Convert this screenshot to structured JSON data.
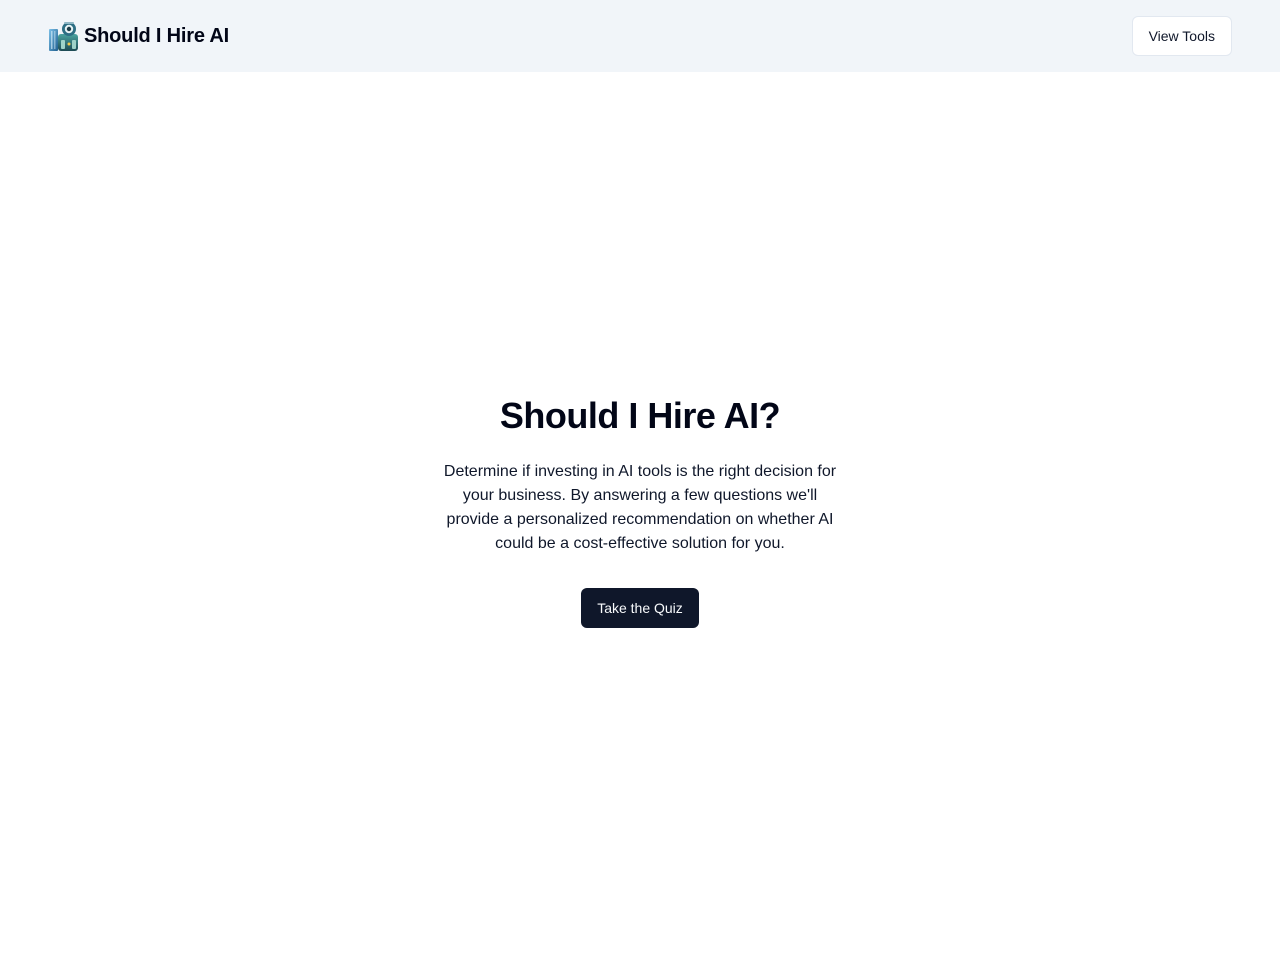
{
  "header": {
    "brand_name": "Should I Hire AI",
    "logo_icon": "robot-briefcase-logo-icon",
    "view_tools_label": "View Tools"
  },
  "hero": {
    "title": "Should I Hire AI?",
    "description": "Determine if investing in AI tools is the right decision for your business. By answering a few questions we'll provide a personalized recommendation on whether AI could be a cost-effective solution for you.",
    "cta_label": "Take the Quiz"
  },
  "colors": {
    "header_bg": "#f1f5f9",
    "primary": "#0f172a",
    "primary_text": "#f8fafc",
    "border": "#e2e8f0"
  }
}
